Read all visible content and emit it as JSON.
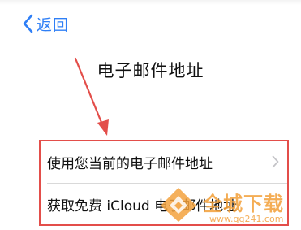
{
  "nav": {
    "back_label": "返回",
    "tint_color": "#2f7ff6"
  },
  "page": {
    "title": "电子邮件地址"
  },
  "options": [
    {
      "label": "使用您当前的电子邮件地址",
      "has_chevron": true
    },
    {
      "label": "获取免费 iCloud 电子邮件地址",
      "has_chevron": false
    }
  ],
  "annotation": {
    "highlight_color": "#e34e4a",
    "arrow_color": "#e34e4a"
  },
  "watermark": {
    "name": "全城下载",
    "url": "www.qq241.com",
    "color": "#f3a23e"
  }
}
